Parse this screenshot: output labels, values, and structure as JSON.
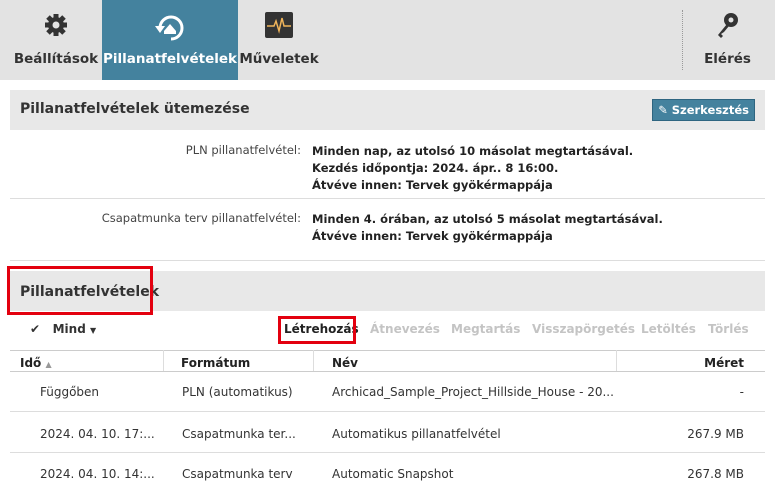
{
  "nav": {
    "tabs": [
      {
        "label": "Beállítások",
        "icon": "gear-icon"
      },
      {
        "label": "Pillanatfelvételek",
        "icon": "snapshot-icon"
      },
      {
        "label": "Műveletek",
        "icon": "activity-icon"
      }
    ],
    "access": {
      "label": "Elérés",
      "icon": "key-icon"
    }
  },
  "schedule": {
    "title": "Pillanatfelvételek ütemezése",
    "edit_label": "Szerkesztés",
    "pln": {
      "label": "PLN pillanatfelvétel:",
      "lines": [
        "Minden nap, az utolsó 10 másolat megtartásával.",
        "Kezdés időpontja: 2024. ápr.. 8 16:00.",
        "Átvéve innen: Tervek gyökérmappája"
      ]
    },
    "team": {
      "label": "Csapatmunka terv pillanatfelvétel:",
      "lines": [
        "Minden 4. órában, az utolsó 5 másolat megtartásával.",
        "Átvéve innen: Tervek gyökérmappája"
      ]
    }
  },
  "snapshots": {
    "title": "Pillanatfelvételek",
    "select_all": "Mind",
    "actions": [
      "Létrehozás",
      "Átnevezés",
      "Megtartás",
      "Visszapörgetés",
      "Letöltés",
      "Törlés"
    ],
    "columns": [
      "Idő",
      "Formátum",
      "Név",
      "Méret"
    ],
    "rows": [
      [
        "Függőben",
        "PLN (automatikus)",
        "Archicad_Sample_Project_Hillside_House - 20...",
        "-"
      ],
      [
        "2024. 04. 10. 17:...",
        "Csapatmunka ter...",
        "Automatikus pillanatfelvétel",
        "267.9 MB"
      ],
      [
        "2024. 04. 10. 14:...",
        "Csapatmunka terv",
        "Automatic Snapshot",
        "267.8 MB"
      ]
    ]
  }
}
